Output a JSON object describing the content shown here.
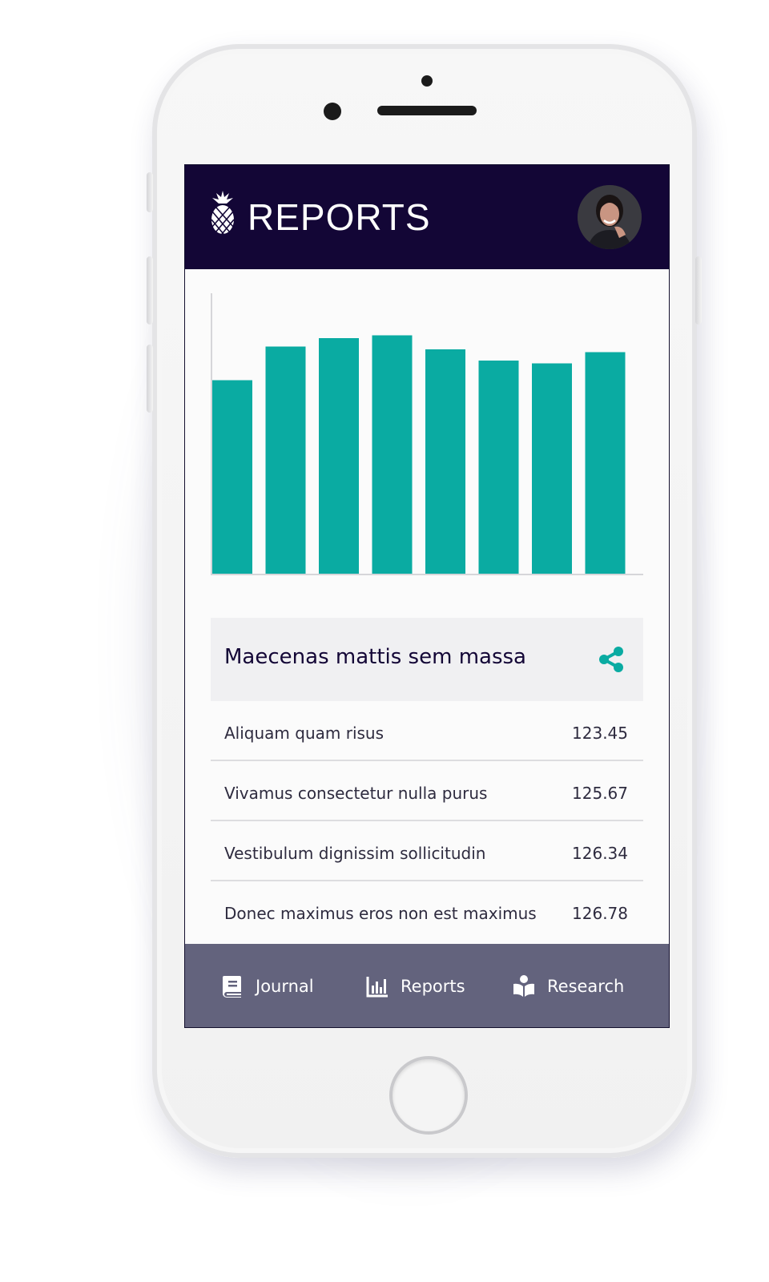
{
  "header": {
    "title": "REPORTS"
  },
  "chart_data": {
    "type": "bar",
    "categories": [
      "",
      "",
      "",
      "",
      "",
      "",
      "",
      ""
    ],
    "values": [
      69,
      81,
      84,
      85,
      80,
      76,
      75,
      79
    ],
    "ylim": [
      0,
      100
    ],
    "color": "#0aaba2",
    "title": "",
    "xlabel": "",
    "ylabel": "",
    "grid": false
  },
  "card": {
    "title": "Maecenas mattis sem massa",
    "share_icon": "share-icon",
    "rows": [
      {
        "label": "Aliquam quam risus",
        "value": "123.45"
      },
      {
        "label": "Vivamus consectetur nulla purus",
        "value": "125.67"
      },
      {
        "label": "Vestibulum dignissim sollicitudin",
        "value": "126.34"
      },
      {
        "label": "Donec maximus eros non est maximus",
        "value": "126.78"
      }
    ]
  },
  "nav": {
    "items": [
      {
        "label": "Journal",
        "icon": "book-icon"
      },
      {
        "label": "Reports",
        "icon": "bar-chart-icon"
      },
      {
        "label": "Research",
        "icon": "reader-icon"
      }
    ]
  },
  "colors": {
    "header_bg": "#130636",
    "accent": "#0aaba2",
    "nav_bg": "#63637d",
    "card_bg": "#f0f0f2"
  }
}
